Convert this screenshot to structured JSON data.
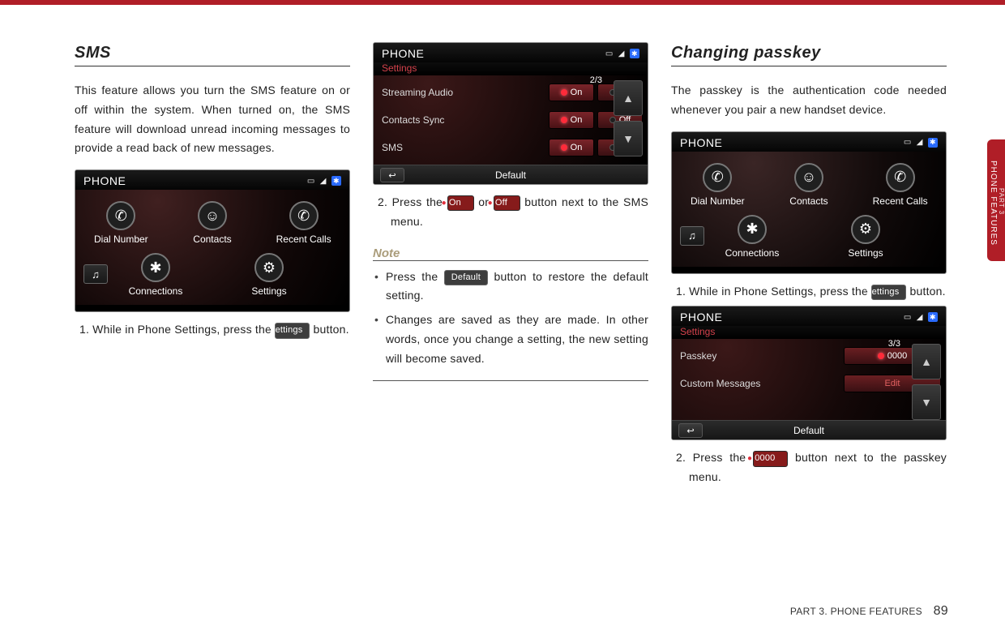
{
  "topbar": {},
  "sidetab": {
    "part": "PART 3",
    "title": "PHONE FEATURES"
  },
  "footer": {
    "crumb": "PART 3. PHONE FEATURES",
    "page": "89"
  },
  "pills": {
    "settings": "Settings",
    "on": "On",
    "off": "Off",
    "default": "Default",
    "zeros": "0000"
  },
  "col1": {
    "title": "SMS",
    "intro": "This feature allows you turn the SMS feature on or off within the system. When turned on, the SMS feature will download unread incoming messages to provide a read back of new messages.",
    "shot": {
      "title": "PHONE",
      "icons": [
        "Dial Number",
        "Contacts",
        "Recent Calls",
        "Connections",
        "Settings"
      ]
    },
    "step1a": "1. While in Phone Settings, press the ",
    "step1b": " button."
  },
  "col2": {
    "shot": {
      "title": "PHONE",
      "sub": "Settings",
      "page": "2/3",
      "rows": [
        "Streaming Audio",
        "Contacts Sync",
        "SMS"
      ],
      "on": "On",
      "off": "Off",
      "default": "Default"
    },
    "step2a": "2. Press the ",
    "step2mid": " or ",
    "step2b": " button next to the SMS menu.",
    "noteHead": "Note",
    "noteItems": {
      "n1a": "Press the ",
      "n1b": " button to restore the default setting.",
      "n2": "Changes are saved as they are made. In other words, once you change a setting, the new setting will become saved."
    }
  },
  "col3": {
    "title": "Changing passkey",
    "intro": "The passkey is the authentication code needed whenever you pair a new handset device.",
    "shot1": {
      "title": "PHONE",
      "icons": [
        "Dial Number",
        "Contacts",
        "Recent Calls",
        "Connections",
        "Settings"
      ]
    },
    "step1a": "1. While in Phone Settings, press the ",
    "step1b": " button.",
    "shot2": {
      "title": "PHONE",
      "sub": "Settings",
      "page": "3/3",
      "rows": {
        "passkey": {
          "label": "Passkey",
          "value": "0000"
        },
        "custom": {
          "label": "Custom Messages",
          "value": "Edit"
        }
      },
      "default": "Default"
    },
    "step2a": "2. Press the ",
    "step2b": " button next to the pass­key menu."
  }
}
